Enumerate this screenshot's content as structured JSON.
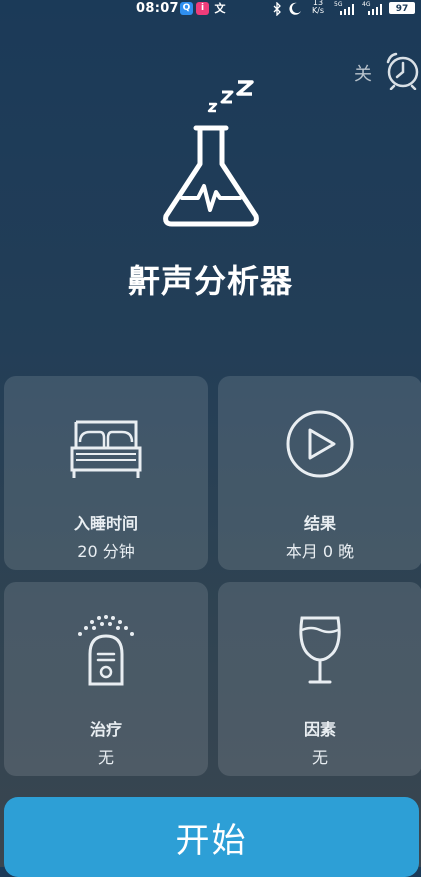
{
  "statusbar": {
    "time": "08:07",
    "app1": "Q",
    "app2": "i",
    "app3": "文",
    "speed_top": "13",
    "speed_bottom": "K/s",
    "net1": "5G",
    "net2": "4G",
    "battery": "97"
  },
  "alarm": {
    "label": "关"
  },
  "app": {
    "title": "鼾声分析器"
  },
  "cards": [
    {
      "label": "入睡时间",
      "value": "20 分钟",
      "icon": "bed-icon"
    },
    {
      "label": "结果",
      "value": "本月 0 晚",
      "icon": "play-icon"
    },
    {
      "label": "治疗",
      "value": "无",
      "icon": "humidifier-icon"
    },
    {
      "label": "因素",
      "value": "无",
      "icon": "wine-glass-icon"
    }
  ],
  "start": {
    "label": "开始"
  },
  "colors": {
    "accent": "#2d9fd6",
    "background_top": "#1b3a58",
    "background_bottom": "#3a4650"
  }
}
